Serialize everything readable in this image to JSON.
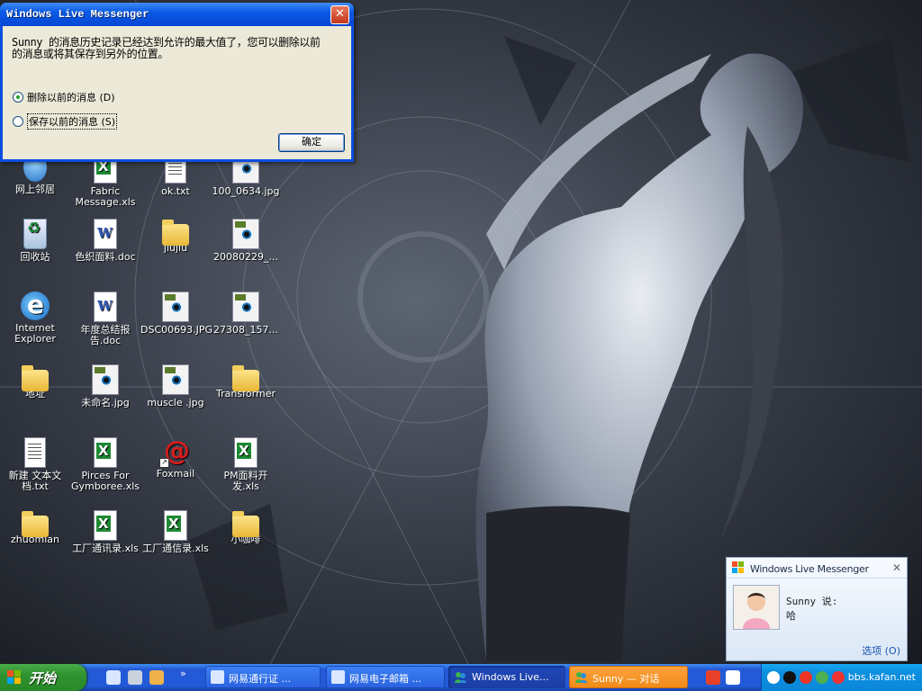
{
  "dialog": {
    "title": "Windows Live Messenger",
    "close_glyph": "✕",
    "message_line1": "Sunny 的消息历史记录已经达到允许的最大值了，您可以删除以前",
    "message_line2": "的消息或将其保存到另外的位置。",
    "option_delete": "删除以前的消息 (D)",
    "option_save": "保存以前的消息 (S)",
    "ok_label": "确定"
  },
  "desktop": {
    "icons": [
      {
        "label": "网上邻居",
        "icon": "network-icon"
      },
      {
        "label": "Fabric Message.xls",
        "icon": "excel-file-icon"
      },
      {
        "label": "ok.txt",
        "icon": "text-file-icon"
      },
      {
        "label": "100_0634.jpg",
        "icon": "image-file-icon"
      },
      {
        "label": "回收站",
        "icon": "recycle-bin-icon"
      },
      {
        "label": "色织面料.doc",
        "icon": "word-file-icon"
      },
      {
        "label": "jiujiu",
        "icon": "folder-icon"
      },
      {
        "label": "20080229_...",
        "icon": "image-file-icon"
      },
      {
        "label": "Internet Explorer",
        "icon": "internet-explorer-icon"
      },
      {
        "label": "年度总结报告.doc",
        "icon": "word-file-icon"
      },
      {
        "label": "DSC00693.JPG",
        "icon": "image-file-icon"
      },
      {
        "label": "27308_157...",
        "icon": "image-file-icon"
      },
      {
        "label": "地址",
        "icon": "folder-icon"
      },
      {
        "label": "未命名.jpg",
        "icon": "image-file-icon"
      },
      {
        "label": "muscle .jpg",
        "icon": "image-file-icon"
      },
      {
        "label": "Transformer",
        "icon": "folder-icon"
      },
      {
        "label": "新建 文本文档.txt",
        "icon": "text-file-icon"
      },
      {
        "label": "Pirces For Gymboree.xls",
        "icon": "excel-file-icon"
      },
      {
        "label": "Foxmail",
        "icon": "foxmail-icon"
      },
      {
        "label": "PM面料开发.xls",
        "icon": "excel-file-icon"
      },
      {
        "label": "zhuomian",
        "icon": "folder-icon"
      },
      {
        "label": "工厂通讯录.xls",
        "icon": "excel-file-icon"
      },
      {
        "label": "工厂通信录.xls",
        "icon": "excel-file-icon"
      },
      {
        "label": "小咖啡",
        "icon": "folder-icon"
      }
    ]
  },
  "toast": {
    "title": "Windows Live Messenger",
    "close_glyph": "✕",
    "sender_line": "Sunny 说:",
    "message": "哈",
    "options_link": "选项 (O)"
  },
  "taskbar": {
    "start_label": "开始",
    "tasks": [
      {
        "label": "网易通行证 ..."
      },
      {
        "label": "网易电子邮箱 ..."
      },
      {
        "label": "Windows Live..."
      },
      {
        "label": "Sunny — 对话"
      }
    ],
    "clock": "bbs.kafan.net",
    "colors": {
      "taskbar": "#245edb",
      "start": "#3c9a3c",
      "tray": "#0f91e2",
      "flash_task": "#f59a2c"
    }
  }
}
